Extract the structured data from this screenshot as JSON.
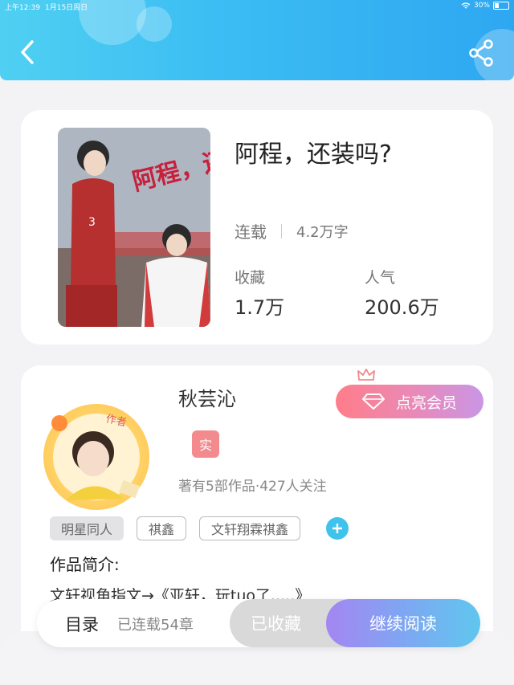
{
  "statusbar": {
    "time": "上午12:39",
    "date": "1月15日周日",
    "battery": "30%"
  },
  "header": {
    "back_icon": "chevron-left-icon",
    "share_icon": "share-icon"
  },
  "book": {
    "cover_alt": "阿程，还装吗?",
    "title": "阿程，还装吗?",
    "status": "连载",
    "word_count": "4.2万字",
    "favorites_label": "收藏",
    "favorites_value": "1.7万",
    "popularity_label": "人气",
    "popularity_value": "200.6万"
  },
  "author": {
    "name": "秋芸沁",
    "avatar_badge": "作者",
    "verify_badge": "实",
    "meta": "著有5部作品·427人关注",
    "vip_button": "点亮会员"
  },
  "tags": [
    "明星同人",
    "祺鑫",
    "文轩翔霖祺鑫"
  ],
  "intro": {
    "label": "作品简介:",
    "text": "文轩视角指文→《亚轩，玩tuo了.....》"
  },
  "bottom_bar": {
    "toc_label": "目录",
    "toc_count": "已连载54章",
    "favorited_label": "已收藏",
    "continue_label": "继续阅读"
  },
  "colors": {
    "header": "#3bbcf3",
    "accent": "#3fc3ec",
    "vip": "#ff7d8a"
  }
}
